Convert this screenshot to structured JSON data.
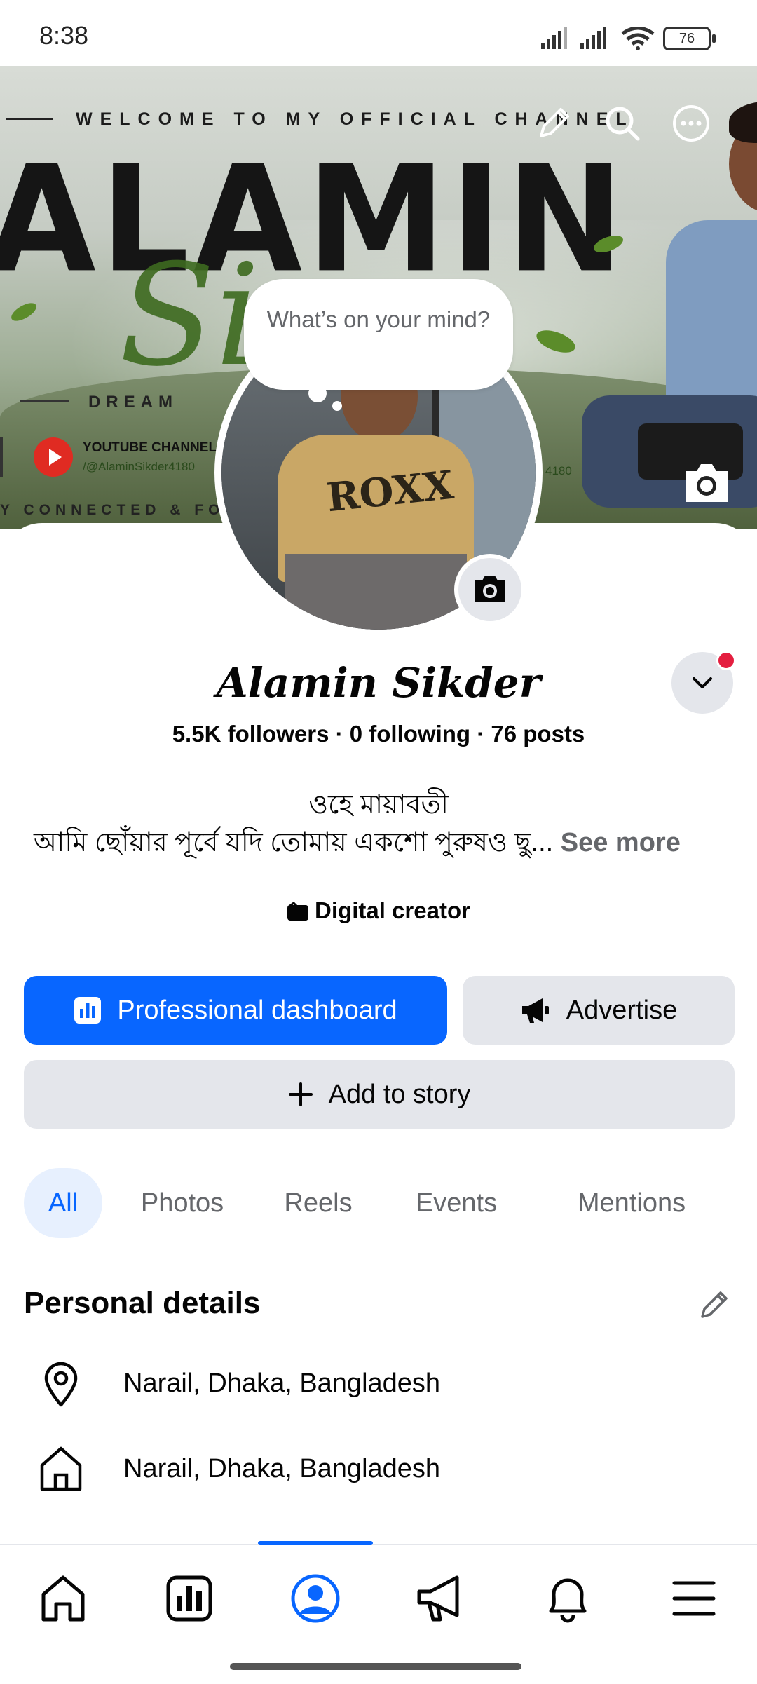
{
  "status": {
    "time": "8:38",
    "battery": "76"
  },
  "cover": {
    "welcome": "WELCOME TO MY OFFICIAL CHANNEL",
    "big_text": "ALAMIN",
    "script_text": "Si",
    "dream": "DREAM",
    "yt_title": "YOUTUBE CHANNEL",
    "yt_handle": "/@AlaminSikder4180",
    "yt_handle_fragment": "4180",
    "connected": "Y CONNECTED & FOLL",
    "icons": [
      "edit-icon",
      "search-icon",
      "more-icon",
      "camera-icon"
    ]
  },
  "profile": {
    "bubble": "What’s on your mind?",
    "avatar_shirt": "ROXX",
    "name": "Alamin Sikder",
    "stats": "5.5K followers · 0 following · 76 posts",
    "bio_line1": "ওহে মায়াবতী",
    "bio_line2": "আমি ছোঁয়ার পূর্বে যদি তোমায় একশো পুরুষও ছু...",
    "see_more": "See more",
    "category": "Digital creator"
  },
  "buttons": {
    "professional_dashboard": "Professional dashboard",
    "advertise": "Advertise",
    "add_to_story": "Add to story"
  },
  "tabs": [
    {
      "label": "All",
      "active": true
    },
    {
      "label": "Photos",
      "active": false
    },
    {
      "label": "Reels",
      "active": false
    },
    {
      "label": "Events",
      "active": false
    },
    {
      "label": "Mentions",
      "active": false
    }
  ],
  "personal_details": {
    "title": "Personal details",
    "rows": [
      {
        "icon": "location-pin-icon",
        "text": "Narail, Dhaka, Bangladesh"
      },
      {
        "icon": "home-icon",
        "text": "Narail, Dhaka, Bangladesh"
      }
    ]
  },
  "nav": [
    "home-icon",
    "dashboard-icon",
    "profile-icon",
    "megaphone-icon",
    "bell-icon",
    "menu-icon"
  ],
  "colors": {
    "accent": "#0866ff",
    "button_gray": "#e4e6eb",
    "text": "#050505",
    "muted": "#65676b",
    "notification": "#e41e3f"
  }
}
